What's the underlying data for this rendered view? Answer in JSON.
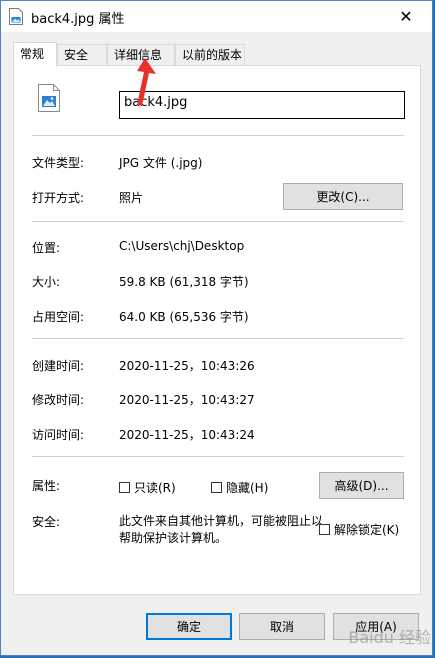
{
  "window": {
    "title": "back4.jpg 属性",
    "close_glyph": "✕"
  },
  "tabs": [
    {
      "label": "常规",
      "active": true
    },
    {
      "label": "安全",
      "active": false
    },
    {
      "label": "详细信息",
      "active": false
    },
    {
      "label": "以前的版本",
      "active": false
    }
  ],
  "general": {
    "file_name": "back4.jpg",
    "file_type_label": "文件类型:",
    "file_type_value": "JPG 文件 (.jpg)",
    "opens_with_label": "打开方式:",
    "opens_with_value": "照片",
    "change_button": "更改(C)...",
    "location_label": "位置:",
    "location_value": "C:\\Users\\chj\\Desktop",
    "size_label": "大小:",
    "size_value": "59.8 KB (61,318 字节)",
    "size_on_disk_label": "占用空间:",
    "size_on_disk_value": "64.0 KB (65,536 字节)",
    "created_label": "创建时间:",
    "created_value": "2020-11-25，10:43:26",
    "modified_label": "修改时间:",
    "modified_value": "2020-11-25，10:43:27",
    "accessed_label": "访问时间:",
    "accessed_value": "2020-11-25，10:43:24",
    "attributes_label": "属性:",
    "readonly_label": "只读(R)",
    "hidden_label": "隐藏(H)",
    "advanced_button": "高级(D)...",
    "security_label": "安全:",
    "security_text": "此文件来自其他计算机，可能被阻止以帮助保护该计算机。",
    "unblock_label": "解除锁定(K)"
  },
  "footer": {
    "ok": "确定",
    "cancel": "取消",
    "apply": "应用(A)"
  },
  "watermark": "Baidu 经验",
  "colors": {
    "accent": "#0078d7",
    "arrow": "#e8312a",
    "border": "#adadad"
  }
}
